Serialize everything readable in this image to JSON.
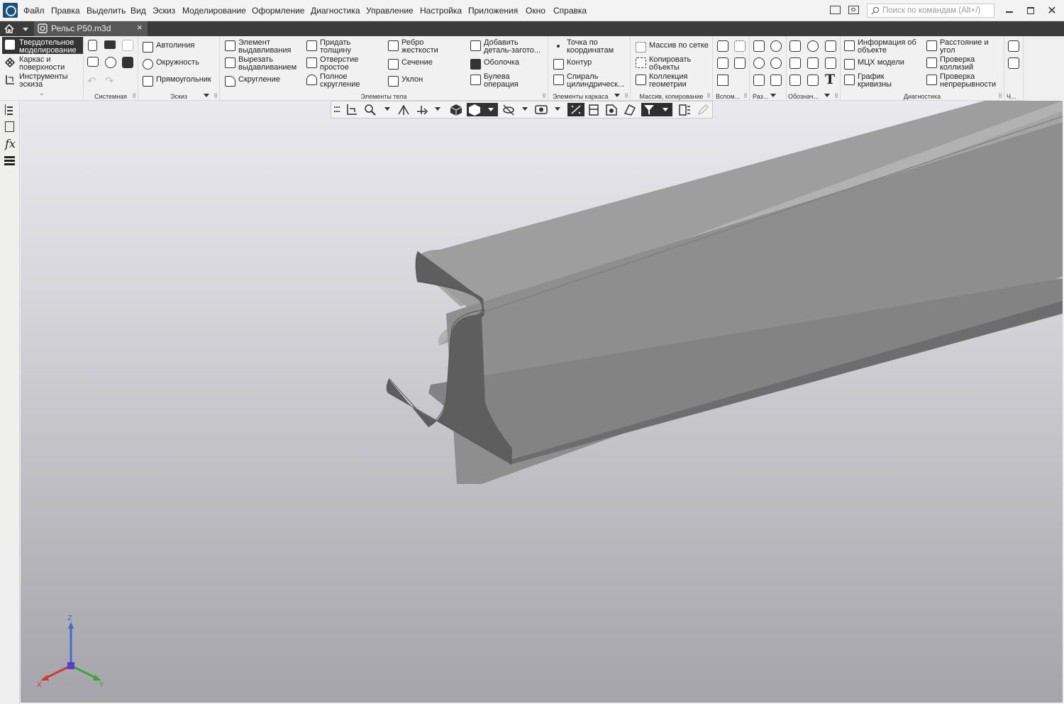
{
  "menu": [
    "Файл",
    "Правка",
    "Выделить",
    "Вид",
    "Эскиз",
    "Моделирование",
    "Оформление",
    "Диагностика",
    "Управление",
    "Настройка",
    "Приложения",
    "Окно",
    "Справка"
  ],
  "search": {
    "placeholder": "Поиск по командам (Alt+/)"
  },
  "tab": {
    "title": "Рельс Р50.m3d",
    "close": "×"
  },
  "modes": {
    "solid": "Твердотельное моделирование",
    "wire_l1": "Каркас и",
    "wire_l2": "поверхности",
    "sketch_l1": "Инструменты",
    "sketch_l2": "эскиза",
    "solid_l1": "Твердотельное",
    "solid_l2": "моделирование"
  },
  "groups": {
    "system": "Системная",
    "sketch": "Эскиз",
    "body": "Элементы тела",
    "frame": "Элементы каркаса",
    "array": "Массив, копирование",
    "aux": "Вспом...",
    "sec": "Раз...",
    "dims": "Обознач...",
    "diag": "Диагностика",
    "more": "Ч..."
  },
  "sketch_items": {
    "autoline": "Автолиния",
    "circle": "Окружность",
    "rect": "Прямоугольник"
  },
  "body_items": {
    "extrude_l1": "Элемент",
    "extrude_l2": "выдавливания",
    "cut_l1": "Вырезать",
    "cut_l2": "выдавливанием",
    "fillet": "Скругление",
    "thick_l1": "Придать",
    "thick_l2": "толщину",
    "hole_l1": "Отверстие",
    "hole_l2": "простое",
    "full_l1": "Полное",
    "full_l2": "скругление",
    "rib_l1": "Ребро",
    "rib_l2": "жесткости",
    "section": "Сечение",
    "draft": "Уклон",
    "add_l1": "Добавить",
    "add_l2": "деталь-загото...",
    "shell": "Оболочка",
    "bool_l1": "Булева",
    "bool_l2": "операция"
  },
  "frame_items": {
    "point_l1": "Точка по",
    "point_l2": "координатам",
    "contour": "Контур",
    "spiral_l1": "Спираль",
    "spiral_l2": "цилиндрическ..."
  },
  "array_items": {
    "grid": "Массив по сетке",
    "copy_l1": "Копировать",
    "copy_l2": "объекты",
    "coll_l1": "Коллекция",
    "coll_l2": "геометрии"
  },
  "diag_items": {
    "info_l1": "Информация об",
    "info_l2": "объекте",
    "mass": "МЦХ модели",
    "curv_l1": "График",
    "curv_l2": "кривизны",
    "dist_l1": "Расстояние и",
    "dist_l2": "угол",
    "coll_l1": "Проверка",
    "coll_l2": "коллизий",
    "cont_l1": "Проверка",
    "cont_l2": "непрерывности"
  },
  "axes": {
    "x": "X",
    "y": "Y",
    "z": "Z"
  },
  "colors": {
    "x": "#d23a3a",
    "y": "#3aa63a",
    "z": "#3a6fd2",
    "model_top": "#9a9a9a",
    "model_side": "#7c7c7c",
    "model_face": "#606060"
  }
}
